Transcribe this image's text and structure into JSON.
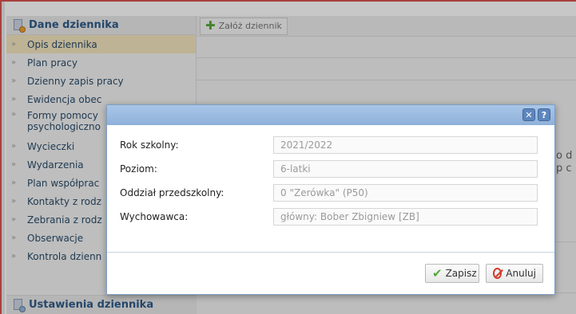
{
  "sidebar": {
    "header": "Dane dziennika",
    "items": [
      {
        "label": "Opis dziennika",
        "active": true
      },
      {
        "label": "Plan pracy"
      },
      {
        "label": "Dzienny zapis pracy"
      },
      {
        "label": "Ewidencja obec"
      },
      {
        "label": "Formy pomocy psychologiczno"
      },
      {
        "label": "Wycieczki"
      },
      {
        "label": "Wydarzenia"
      },
      {
        "label": "Plan współprac"
      },
      {
        "label": "Kontakty z rodz"
      },
      {
        "label": "Zebrania z rodz"
      },
      {
        "label": "Obserwacje"
      },
      {
        "label": "Kontrola dzienn"
      }
    ],
    "footer": "Ustawienia dziennika"
  },
  "toolbar": {
    "add_label": "Załóż dziennik"
  },
  "background_text": {
    "line1": "o d",
    "line2": "p c"
  },
  "modal": {
    "fields": [
      {
        "label": "Rok szkolny:",
        "value": "2021/2022"
      },
      {
        "label": "Poziom:",
        "value": "6-latki"
      },
      {
        "label": "Oddział przedszkolny:",
        "value": "0 \"Zerówka\" (P50)"
      },
      {
        "label": "Wychowawca:",
        "value": "główny: Bober Zbigniew [ZB]"
      }
    ],
    "save_label": "Zapisz",
    "cancel_label": "Anuluj",
    "close_glyph": "✕",
    "help_glyph": "?"
  },
  "colors": {
    "accent": "#2f5c8a",
    "active_item": "#f4e6bf",
    "titlebar": "#8fb1da",
    "frame": "#d9534f"
  }
}
